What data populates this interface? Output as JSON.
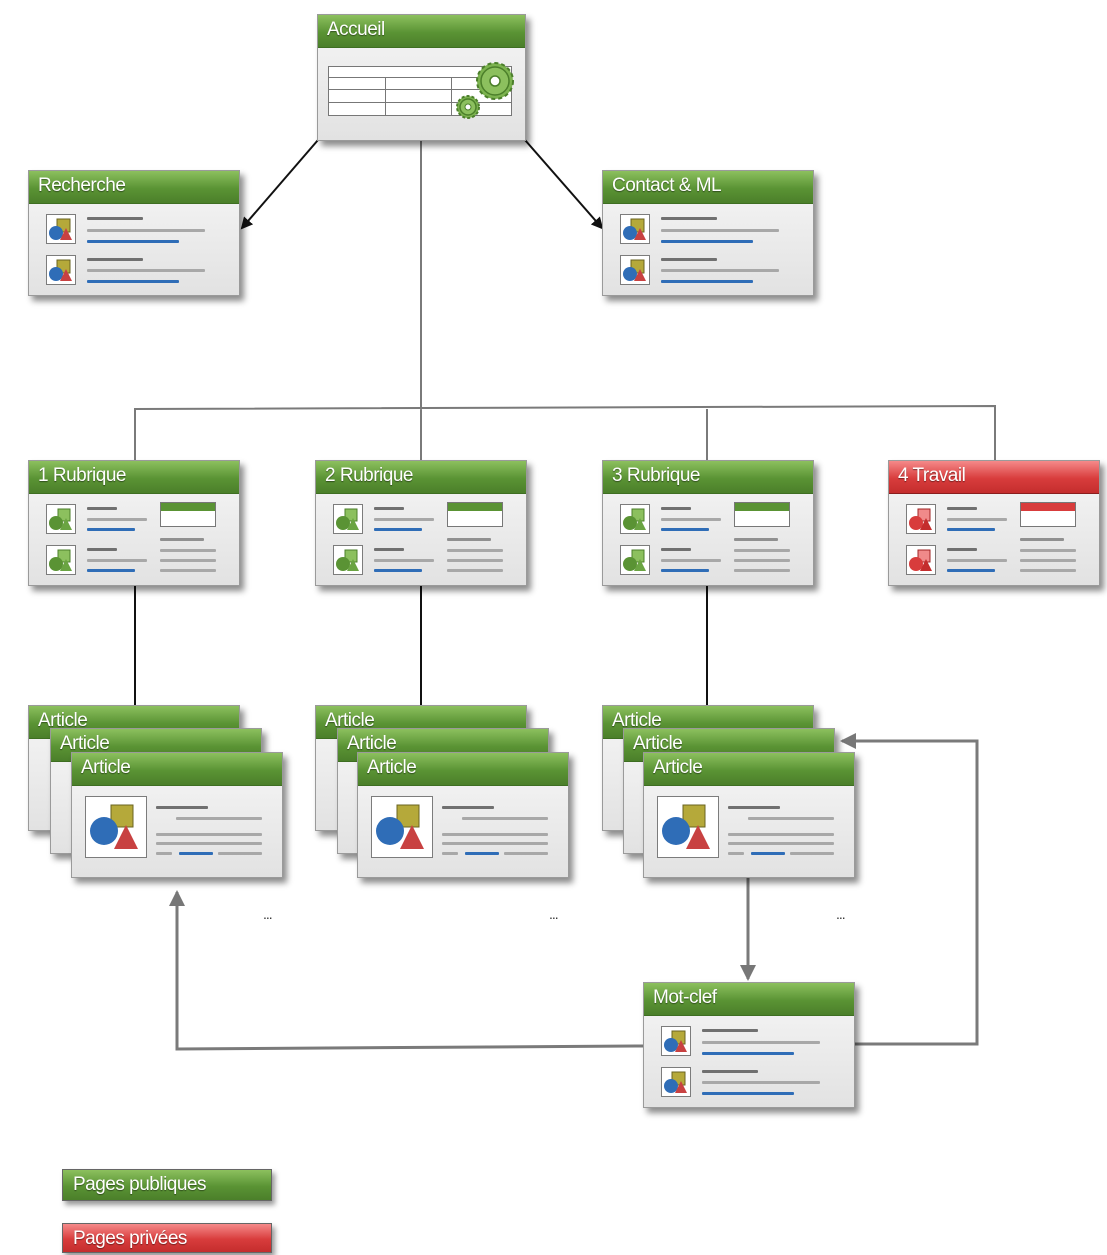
{
  "nodes": {
    "accueil": "Accueil",
    "recherche": "Recherche",
    "contact": "Contact & ML",
    "rubrique1": "1 Rubrique",
    "rubrique2": "2 Rubrique",
    "rubrique3": "3 Rubrique",
    "travail": "4 Travail",
    "article": "Article",
    "motclef": "Mot-clef"
  },
  "ellipsis": "...",
  "legend": {
    "public": "Pages publiques",
    "private": "Pages privées"
  },
  "colors": {
    "public": "#5a9334",
    "private": "#d83c3c",
    "connector": "#7a7a7a"
  }
}
